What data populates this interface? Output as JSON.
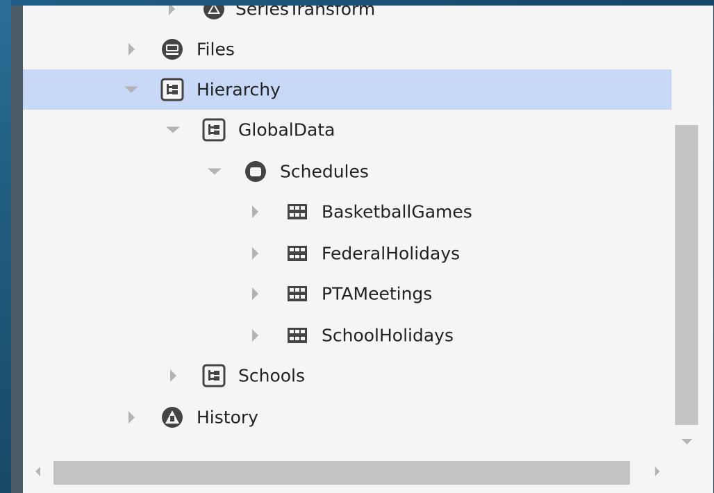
{
  "tree": {
    "items": [
      {
        "label": "SeriesTransform",
        "icon": "series-transform-icon",
        "state": "collapsed"
      },
      {
        "label": "Files",
        "icon": "files-icon",
        "state": "collapsed"
      },
      {
        "label": "Hierarchy",
        "icon": "hierarchy-icon",
        "state": "expanded",
        "selected": true
      },
      {
        "label": "GlobalData",
        "icon": "hierarchy-icon",
        "state": "expanded"
      },
      {
        "label": "Schedules",
        "icon": "folder-icon",
        "state": "expanded"
      },
      {
        "label": "BasketballGames",
        "icon": "schedule-grid-icon",
        "state": "collapsed"
      },
      {
        "label": "FederalHolidays",
        "icon": "schedule-grid-icon",
        "state": "collapsed"
      },
      {
        "label": "PTAMeetings",
        "icon": "schedule-grid-icon",
        "state": "collapsed"
      },
      {
        "label": "SchoolHolidays",
        "icon": "schedule-grid-icon",
        "state": "collapsed"
      },
      {
        "label": "Schools",
        "icon": "hierarchy-icon",
        "state": "collapsed"
      },
      {
        "label": "History",
        "icon": "history-icon",
        "state": "collapsed"
      }
    ]
  },
  "colors": {
    "selection": "#c7d9f6",
    "panel": "#f5f5f5",
    "icon": "#444444"
  }
}
